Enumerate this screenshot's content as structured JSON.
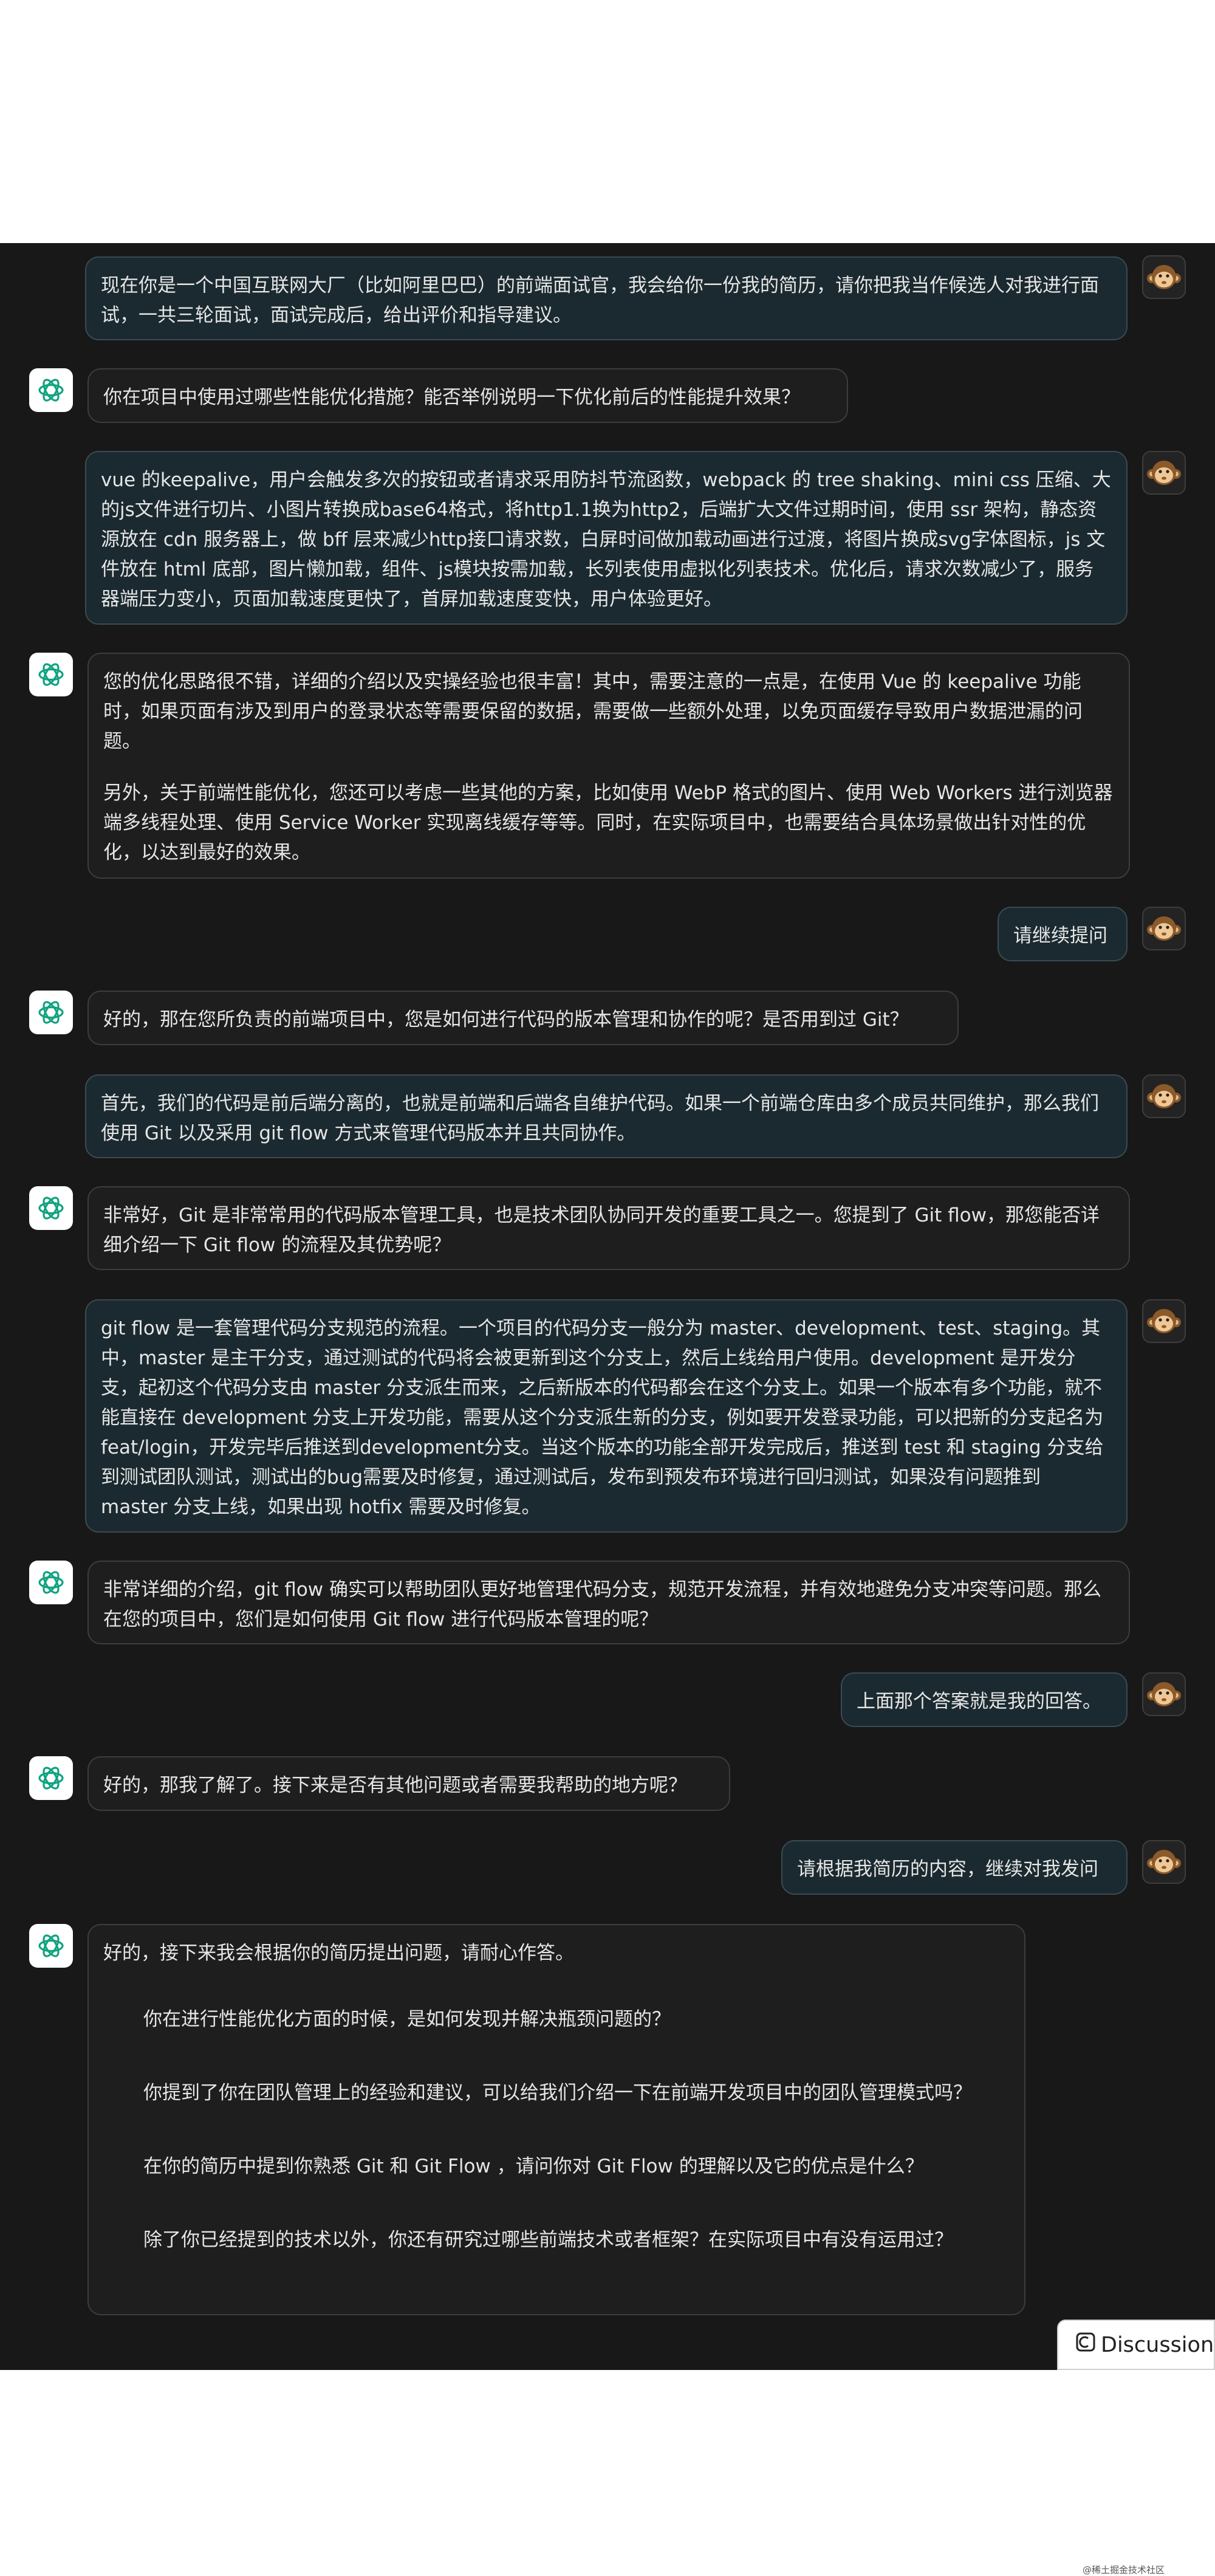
{
  "messages": [
    {
      "role": "user",
      "paragraphs": [
        "现在你是一个中国互联网大厂（比如阿里巴巴）的前端面试官，我会给你一份我的简历，请你把我当作候选人对我进行面试，一共三轮面试，面试完成后，给出评价和指导建议。"
      ]
    },
    {
      "role": "assistant",
      "paragraphs": [
        "你在项目中使用过哪些性能优化措施？能否举例说明一下优化前后的性能提升效果？"
      ]
    },
    {
      "role": "user",
      "paragraphs": [
        "vue 的keepalive，用户会触发多次的按钮或者请求采用防抖节流函数，webpack 的 tree shaking、mini css 压缩、大的js文件进行切片、小图片转换成base64格式，将http1.1换为http2，后端扩大文件过期时间，使用 ssr 架构，静态资源放在 cdn 服务器上，做 bff 层来减少http接口请求数，白屏时间做加载动画进行过渡，将图片换成svg字体图标，js 文件放在 html 底部，图片懒加载，组件、js模块按需加载，长列表使用虚拟化列表技术。优化后，请求次数减少了，服务器端压力变小，页面加载速度更快了，首屏加载速度变快，用户体验更好。"
      ]
    },
    {
      "role": "assistant",
      "paragraphs": [
        "您的优化思路很不错，详细的介绍以及实操经验也很丰富！其中，需要注意的一点是，在使用 Vue 的 keepalive 功能时，如果页面有涉及到用户的登录状态等需要保留的数据，需要做一些额外处理，以免页面缓存导致用户数据泄漏的问题。",
        "另外，关于前端性能优化，您还可以考虑一些其他的方案，比如使用 WebP 格式的图片、使用 Web Workers 进行浏览器端多线程处理、使用 Service Worker 实现离线缓存等等。同时，在实际项目中，也需要结合具体场景做出针对性的优化，以达到最好的效果。"
      ]
    },
    {
      "role": "user",
      "paragraphs": [
        "请继续提问"
      ]
    },
    {
      "role": "assistant",
      "paragraphs": [
        "好的，那在您所负责的前端项目中，您是如何进行代码的版本管理和协作的呢？是否用到过 Git？"
      ]
    },
    {
      "role": "user",
      "paragraphs": [
        "首先，我们的代码是前后端分离的，也就是前端和后端各自维护代码。如果一个前端仓库由多个成员共同维护，那么我们使用 Git 以及采用 git flow 方式来管理代码版本并且共同协作。"
      ]
    },
    {
      "role": "assistant",
      "paragraphs": [
        "非常好，Git 是非常常用的代码版本管理工具，也是技术团队协同开发的重要工具之一。您提到了 Git flow，那您能否详细介绍一下 Git flow 的流程及其优势呢？"
      ]
    },
    {
      "role": "user",
      "paragraphs": [
        "git flow 是一套管理代码分支规范的流程。一个项目的代码分支一般分为 master、development、test、staging。其中，master 是主干分支，通过测试的代码将会被更新到这个分支上，然后上线给用户使用。development 是开发分支，起初这个代码分支由 master 分支派生而来，之后新版本的代码都会在这个分支上。如果一个版本有多个功能，就不能直接在 development 分支上开发功能，需要从这个分支派生新的分支，例如要开发登录功能，可以把新的分支起名为 feat/login，开发完毕后推送到development分支。当这个版本的功能全部开发完成后，推送到 test 和 staging 分支给到测试团队测试，测试出的bug需要及时修复，通过测试后，发布到预发布环境进行回归测试，如果没有问题推到 master 分支上线，如果出现 hotfix 需要及时修复。"
      ]
    },
    {
      "role": "assistant",
      "paragraphs": [
        "非常详细的介绍，git flow 确实可以帮助团队更好地管理代码分支，规范开发流程，并有效地避免分支冲突等问题。那么在您的项目中，您们是如何使用 Git flow 进行代码版本管理的呢？"
      ]
    },
    {
      "role": "user",
      "paragraphs": [
        "上面那个答案就是我的回答。"
      ]
    },
    {
      "role": "assistant",
      "paragraphs": [
        "好的，那我了解了。接下来是否有其他问题或者需要我帮助的地方呢？"
      ]
    },
    {
      "role": "user",
      "paragraphs": [
        "请根据我简历的内容，继续对我发问"
      ]
    },
    {
      "role": "assistant",
      "paragraphs": [
        "好的，接下来我会根据你的简历提出问题，请耐心作答。"
      ],
      "questions": [
        "你在进行性能优化方面的时候，是如何发现并解决瓶颈问题的？",
        "你提到了你在团队管理上的经验和建议，可以给我们介绍一下在前端开发项目中的团队管理模式吗？",
        "在你的简历中提到你熟悉 Git 和 Git Flow ，请问你对 Git Flow 的理解以及它的优点是什么？",
        "除了你已经提到的技术以外，你还有研究过哪些前端技术或者框架？在实际项目中有没有运用过？"
      ]
    }
  ],
  "footer": {
    "discussion_label": "Discussion",
    "watermark": "@稀土掘金技术社区"
  },
  "icons": {
    "user_avatar": "monkey-face-icon",
    "assistant_avatar": "openai-logo-icon",
    "discussion": "discussion-icon"
  },
  "colors": {
    "background": "#181818",
    "user_bubble": "#1b2a30",
    "assistant_bubble": "#1e1e1e",
    "assistant_logo": "#10a37f"
  }
}
